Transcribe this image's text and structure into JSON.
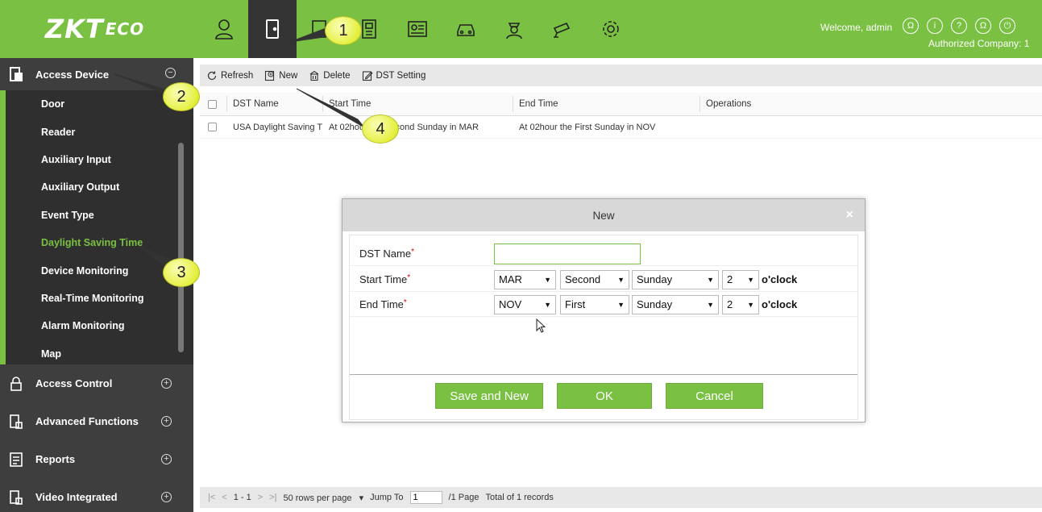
{
  "brand": {
    "logo_main": "ZKT",
    "logo_sub": "ECO"
  },
  "header": {
    "modules": [
      "personnel-icon",
      "access-door-icon",
      "attendance-icon",
      "elevator-icon",
      "visitor-icon",
      "parking-icon",
      "patrol-icon",
      "video-icon",
      "system-settings-icon"
    ],
    "active_module": 1,
    "welcome": "Welcome, admin",
    "company": "Authorized Company: 1"
  },
  "sidebar": {
    "section_title": "Access Device",
    "items": [
      {
        "label": "Door"
      },
      {
        "label": "Reader"
      },
      {
        "label": "Auxiliary Input"
      },
      {
        "label": "Auxiliary Output"
      },
      {
        "label": "Event Type"
      },
      {
        "label": "Daylight Saving Time"
      },
      {
        "label": "Device Monitoring"
      },
      {
        "label": "Real-Time Monitoring"
      },
      {
        "label": "Alarm Monitoring"
      },
      {
        "label": "Map"
      }
    ],
    "active_item": "Daylight Saving Time",
    "groups": [
      {
        "label": "Access Control"
      },
      {
        "label": "Advanced Functions"
      },
      {
        "label": "Reports"
      },
      {
        "label": "Video Integrated"
      }
    ]
  },
  "toolbar": {
    "refresh": "Refresh",
    "new": "New",
    "delete": "Delete",
    "dst_setting": "DST Setting"
  },
  "table": {
    "columns": [
      "DST Name",
      "Start Time",
      "End Time",
      "Operations"
    ],
    "rows": [
      {
        "name": "USA Daylight Saving Time",
        "start": "At 02hour the Second Sunday in MAR",
        "end": "At 02hour the First Sunday in NOV",
        "ops": ""
      }
    ]
  },
  "pager": {
    "first": "|<",
    "prev": "<",
    "range": "1 - 1",
    "next": ">",
    "last": ">|",
    "rows_per_page": "50 rows per page",
    "jump_label": "Jump To",
    "jump_value": "1",
    "page_info": "/1 Page",
    "total": "Total of 1 records"
  },
  "dialog": {
    "title": "New",
    "close": "×",
    "fields": {
      "dst_name_label": "DST Name",
      "start_label": "Start Time",
      "end_label": "End Time",
      "required_mark": "*",
      "start": {
        "month": "MAR",
        "week": "Second",
        "day": "Sunday",
        "hour": "2"
      },
      "end": {
        "month": "NOV",
        "week": "First",
        "day": "Sunday",
        "hour": "2"
      },
      "oclock": "o'clock"
    },
    "buttons": {
      "save_new": "Save and New",
      "ok": "OK",
      "cancel": "Cancel"
    }
  },
  "callouts": [
    "1",
    "2",
    "3",
    "4"
  ],
  "colors": {
    "brand_green": "#7ac143",
    "sidebar_dark": "#3e3e3e",
    "callout_yellow": "#e4ef3d"
  }
}
